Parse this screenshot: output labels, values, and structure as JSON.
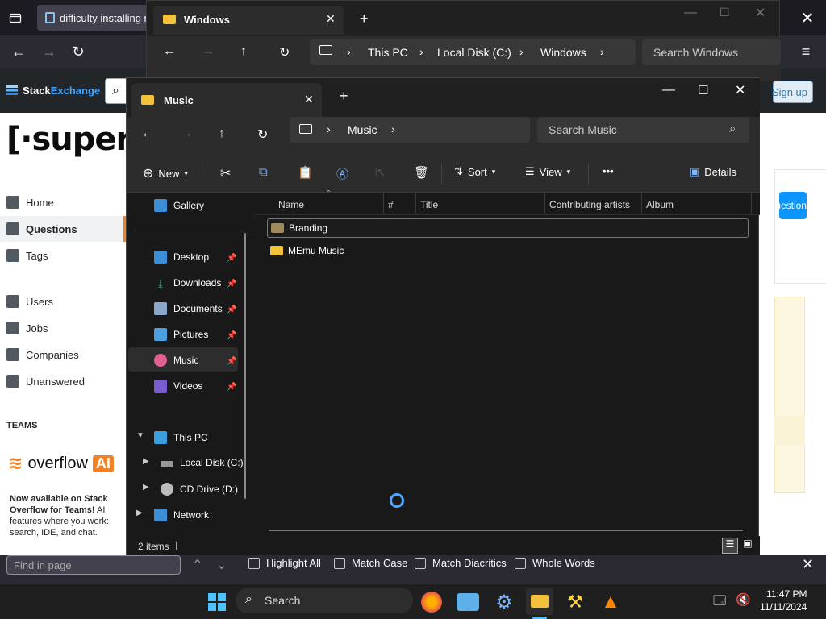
{
  "firefox": {
    "tab_title": "difficulty installing m",
    "find_bar": {
      "placeholder": "Find in page",
      "highlight_all": "Highlight All",
      "match_case": "Match Case",
      "match_diacritics": "Match Diacritics",
      "whole_words": "Whole Words"
    }
  },
  "stackexchange": {
    "logo_left": "Stack",
    "logo_right": "Exchange",
    "site_logo": "superu",
    "signup": "Sign up",
    "ask_question": "Ask Question",
    "nav": {
      "home": "Home",
      "questions": "Questions",
      "tags": "Tags",
      "users": "Users",
      "jobs": "Jobs",
      "companies": "Companies",
      "unanswered": "Unanswered"
    },
    "teams_label": "TEAMS",
    "overflow_ai_text": "overflow",
    "overflow_ai_badge": "AI",
    "ai_promo_bold": "Now available on Stack Overflow for Teams!",
    "ai_promo_text": " AI features where you work: search, IDE, and chat."
  },
  "explorer_back": {
    "tab_title": "Windows",
    "breadcrumb": [
      "This PC",
      "Local Disk (C:)",
      "Windows"
    ],
    "search_placeholder": "Search Windows"
  },
  "explorer_front": {
    "tab_title": "Music",
    "breadcrumb": [
      "Music"
    ],
    "search_placeholder": "Search Music",
    "toolbar": {
      "new": "New",
      "sort": "Sort",
      "view": "View",
      "more": "•••",
      "details": "Details"
    },
    "nav_tree": {
      "gallery": "Gallery",
      "desktop": "Desktop",
      "downloads": "Downloads",
      "documents": "Documents",
      "pictures": "Pictures",
      "music": "Music",
      "videos": "Videos",
      "this_pc": "This PC",
      "local_disk": "Local Disk (C:)",
      "cd_drive": "CD Drive (D:)",
      "network": "Network"
    },
    "columns": [
      "Name",
      "#",
      "Title",
      "Contributing artists",
      "Album"
    ],
    "items": [
      "Branding",
      "MEmu Music"
    ],
    "status": "2 items"
  },
  "taskbar": {
    "search_label": "Search",
    "time": "11:47 PM",
    "date": "11/11/2024"
  },
  "colors": {
    "explorer_bg": "#191919",
    "firefox_bg": "#1c1b22",
    "so_orange": "#f48225",
    "accent_blue": "#0a95ff"
  }
}
